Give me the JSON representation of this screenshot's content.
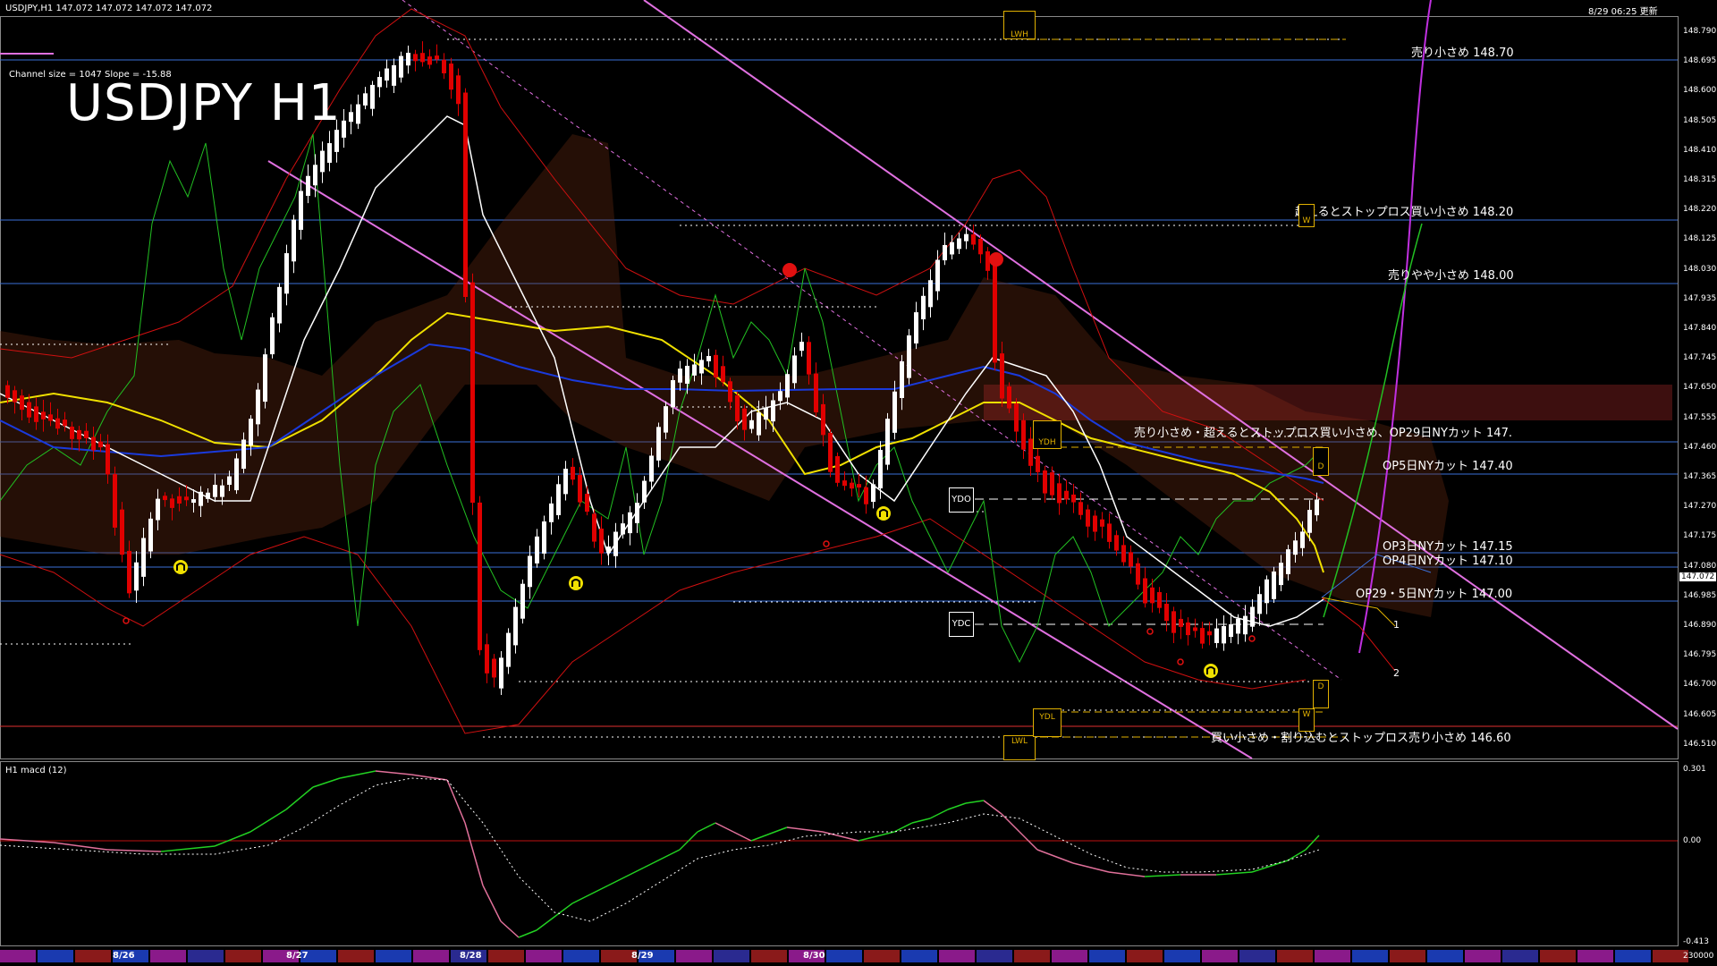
{
  "header": {
    "symbol_info": "USDJPY,H1  147.072 147.072 147.072 147.072",
    "timestamp": "8/29 06:25 更新"
  },
  "chart_title": "USDJPY H1",
  "channel_info": "Channel size = 1047 Slope = -15.88",
  "macd_title": "H1  macd (12)",
  "price_axis": {
    "ticks": [
      "148.790",
      "148.695",
      "148.600",
      "148.505",
      "148.410",
      "148.315",
      "148.220",
      "148.125",
      "148.030",
      "147.935",
      "147.840",
      "147.745",
      "147.650",
      "147.555",
      "147.460",
      "147.365",
      "147.270",
      "147.175",
      "147.080",
      "146.985",
      "146.890",
      "146.795",
      "146.700",
      "146.605",
      "146.510"
    ],
    "current_price": "147.072"
  },
  "macd_axis": {
    "ticks": [
      "0.301",
      "0.00",
      "-0.413",
      "230000"
    ]
  },
  "levels": [
    {
      "label": "売り小さめ 148.70",
      "color": "#3a6fd8"
    },
    {
      "label": "超えるとストップロス買い小さめ 148.20",
      "color": "#3a6fd8"
    },
    {
      "label": "売りやや小さめ 148.00",
      "color": "#3a6fd8"
    },
    {
      "label": "売り小さめ・超えるとストップロス買い小さめ、OP29日NYカット 147.",
      "color": "#3a6fd8"
    },
    {
      "label": "OP5日NYカット 147.40",
      "color": "#3a6fd8"
    },
    {
      "label": "OP3日NYカット 147.15",
      "color": "#3a6fd8"
    },
    {
      "label": "OP4日NYカット 147.10",
      "color": "#3a6fd8"
    },
    {
      "label": "OP29・5日NYカット 147.00",
      "color": "#3a6fd8"
    },
    {
      "label": "買い小さめ・割り込むとストップロス売り小さめ 146.60",
      "color": "#e03030"
    }
  ],
  "markers": {
    "lwh": "LWH",
    "lwl": "LWL",
    "ydh": "YDH",
    "ydl": "YDL",
    "ydo": "YDO",
    "ydc": "YDC",
    "w_top": "W",
    "w_bottom": "W",
    "d_top": "D",
    "d_bottom": "D",
    "wave_1": "1",
    "wave_2": "2"
  },
  "date_axis": [
    "8/26",
    "8/27",
    "8/28",
    "8/29",
    "8/30"
  ],
  "colors": {
    "background": "#000000",
    "candle_up": "#ffffff",
    "candle_down": "#e00000",
    "ma_yellow": "#f0e000",
    "ma_blue": "#1a3adc",
    "ma_white": "#ffffff",
    "channel": "#e070e0",
    "level_blue": "#3a6fd8",
    "level_red": "#e03030",
    "macd_green": "#22d022",
    "macd_pink": "#e0709a"
  }
}
